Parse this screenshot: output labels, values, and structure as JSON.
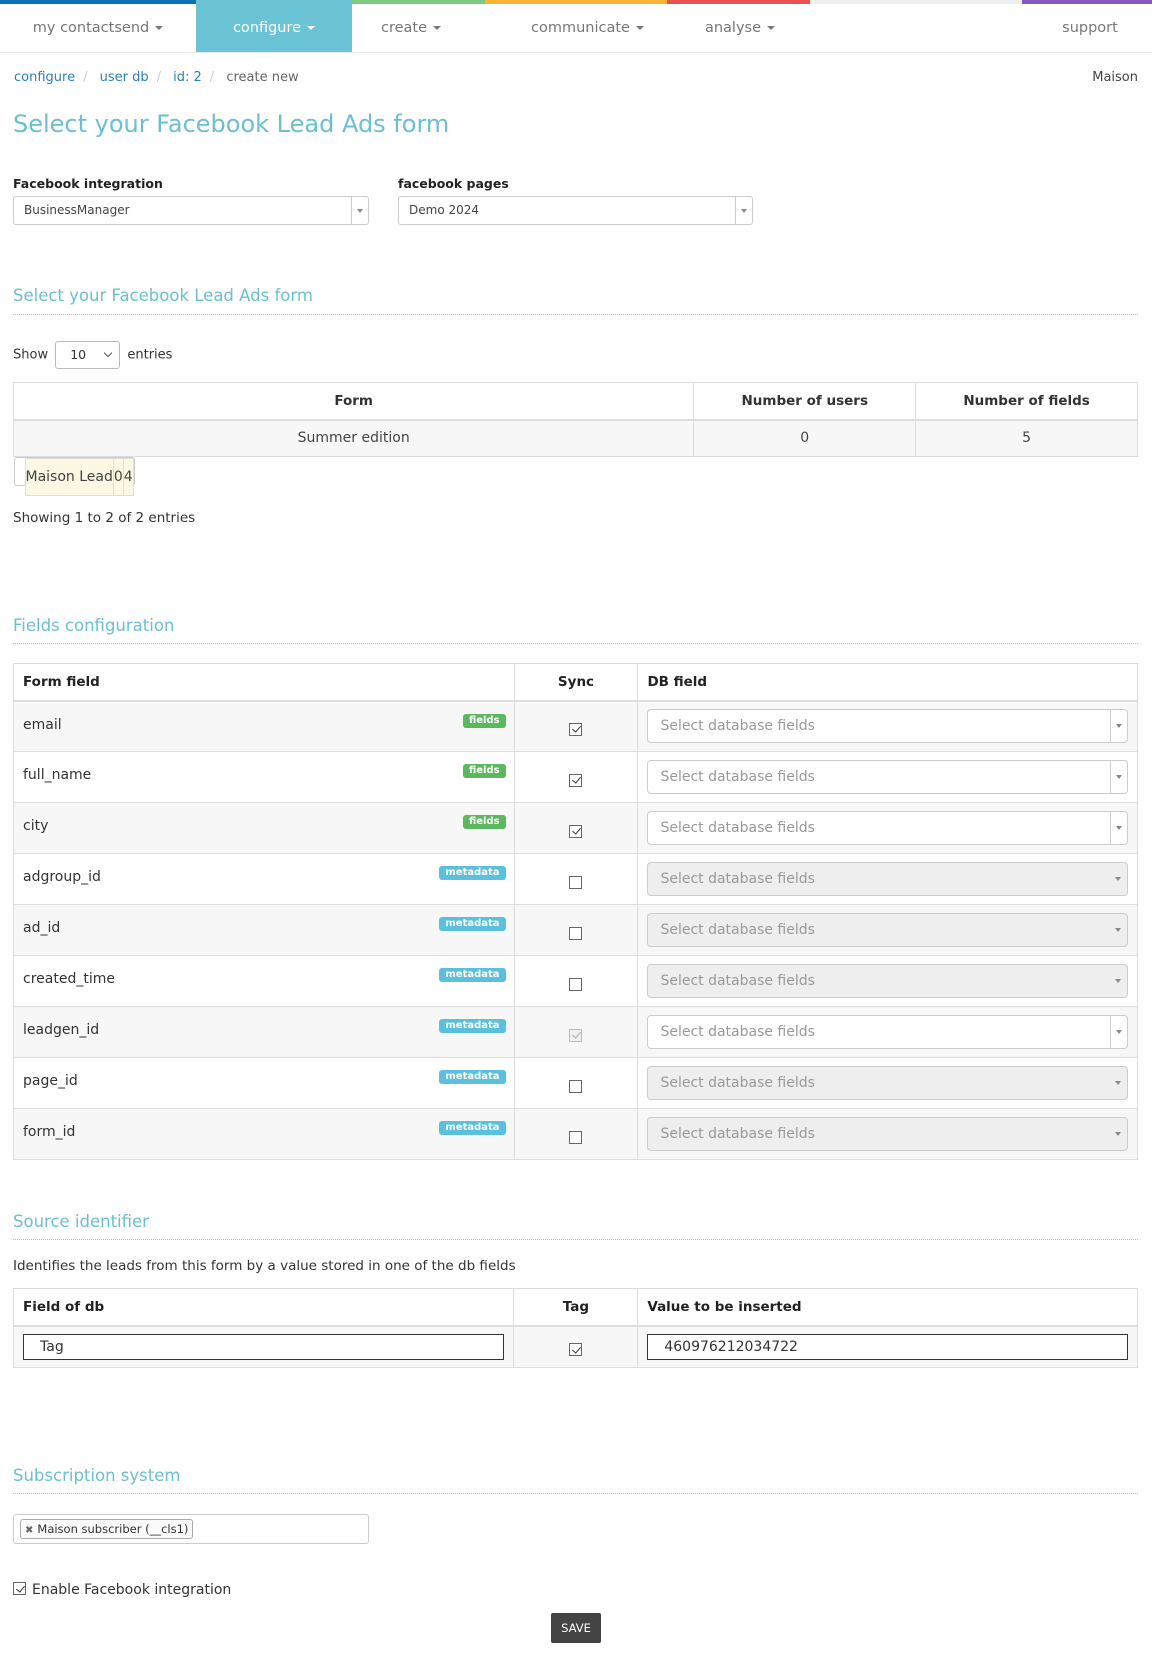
{
  "nav": {
    "items": [
      {
        "label": "my contactsend",
        "color": "#0b6fb0",
        "dropdown": true
      },
      {
        "label": "configure",
        "color": "#6bc4d5",
        "dropdown": true,
        "active": true
      },
      {
        "label": "create",
        "color": "#7fc882",
        "dropdown": true
      },
      {
        "label": "communicate",
        "color": "#f7b233",
        "dropdown": true
      },
      {
        "label": "analyse",
        "color": "#e8514f",
        "dropdown": true
      },
      {
        "label": "support",
        "color": "#8559c2",
        "dropdown": false
      }
    ]
  },
  "breadcrumb": [
    "configure",
    "user db",
    "id: 2",
    "create new"
  ],
  "tenant": "Maison",
  "page_title": "Select your Facebook Lead Ads form",
  "integration": {
    "label": "Facebook integration",
    "value": "BusinessManager"
  },
  "pages": {
    "label": "facebook pages",
    "value": "Demo 2024"
  },
  "forms_section": {
    "title": "Select your Facebook Lead Ads form",
    "show_label": "Show",
    "show_value": "10",
    "entries_label": "entries",
    "columns": [
      "Form",
      "Number of users",
      "Number of fields"
    ],
    "rows": [
      {
        "form": "Summer edition",
        "users": "0",
        "fields": "5",
        "selected": false
      },
      {
        "form": "Maison Lead",
        "users": "0",
        "fields": "4",
        "selected": true
      }
    ],
    "info": "Showing 1 to 2 of 2 entries"
  },
  "fields_section": {
    "title": "Fields configuration",
    "columns": [
      "Form field",
      "Sync",
      "DB field"
    ],
    "placeholder": "Select database fields",
    "rows": [
      {
        "name": "email",
        "badge": "fields",
        "sync": true,
        "sync_disabled": false,
        "db_disabled": false
      },
      {
        "name": "full_name",
        "badge": "fields",
        "sync": true,
        "sync_disabled": false,
        "db_disabled": false
      },
      {
        "name": "city",
        "badge": "fields",
        "sync": true,
        "sync_disabled": false,
        "db_disabled": false
      },
      {
        "name": "adgroup_id",
        "badge": "metadata",
        "sync": false,
        "sync_disabled": false,
        "db_disabled": true
      },
      {
        "name": "ad_id",
        "badge": "metadata",
        "sync": false,
        "sync_disabled": false,
        "db_disabled": true
      },
      {
        "name": "created_time",
        "badge": "metadata",
        "sync": false,
        "sync_disabled": false,
        "db_disabled": true
      },
      {
        "name": "leadgen_id",
        "badge": "metadata",
        "sync": true,
        "sync_disabled": true,
        "db_disabled": false
      },
      {
        "name": "page_id",
        "badge": "metadata",
        "sync": false,
        "sync_disabled": false,
        "db_disabled": true
      },
      {
        "name": "form_id",
        "badge": "metadata",
        "sync": false,
        "sync_disabled": false,
        "db_disabled": true
      }
    ]
  },
  "source_section": {
    "title": "Source identifier",
    "description": "Identifies the leads from this form by a value stored in one of the db fields",
    "columns": [
      "Field of db",
      "Tag",
      "Value to be inserted"
    ],
    "field_value": "Tag",
    "tag_checked": true,
    "value": "460976212034722"
  },
  "subscription_section": {
    "title": "Subscription system",
    "chips": [
      "Maison subscriber (__cls1)"
    ]
  },
  "enable_label": "Enable Facebook integration",
  "enable_checked": true,
  "save_label": "SAVE"
}
